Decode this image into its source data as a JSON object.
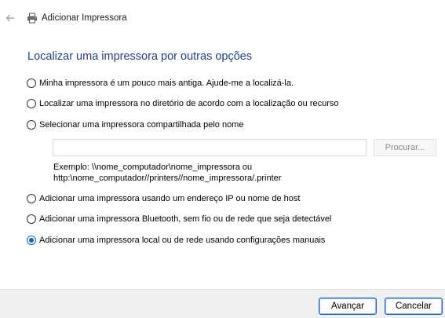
{
  "window": {
    "title": "Adicionar Impressora",
    "corner_mark": "'"
  },
  "heading": "Localizar uma impressora por outras opções",
  "options": [
    {
      "label": "Minha impressora é um pouco mais antiga. Ajude-me a localizá-la.",
      "checked": false
    },
    {
      "label": "Localizar uma impressora no diretório de acordo com a localização ou recurso",
      "checked": false
    },
    {
      "label": "Selecionar uma impressora compartilhada pelo nome",
      "checked": false
    },
    {
      "label": "Adicionar uma impressora usando um endereço IP ou nome de host",
      "checked": false
    },
    {
      "label": "Adicionar uma impressora Bluetooth, sem fio ou de rede que seja detectável",
      "checked": false
    },
    {
      "label": "Adicionar uma impressora local ou de rede usando configurações manuais",
      "checked": true
    }
  ],
  "shared_name": {
    "value": "",
    "browse_label": "Procurar...",
    "example_line1": "Exemplo: \\\\nome_computador\\nome_impressora ou",
    "example_line2": "http:\\nome_computador//printers//nome_impressora/.printer"
  },
  "footer": {
    "next_label": "Avançar",
    "cancel_label": "Cancelar"
  },
  "icons": {
    "back": "arrow-left-icon",
    "app": "printer-icon"
  },
  "colors": {
    "heading": "#1e3f8a",
    "radio_selected": "#0a5fc9",
    "button_focus_border": "#1a64c8",
    "footer_bg": "#f0f0f0"
  }
}
